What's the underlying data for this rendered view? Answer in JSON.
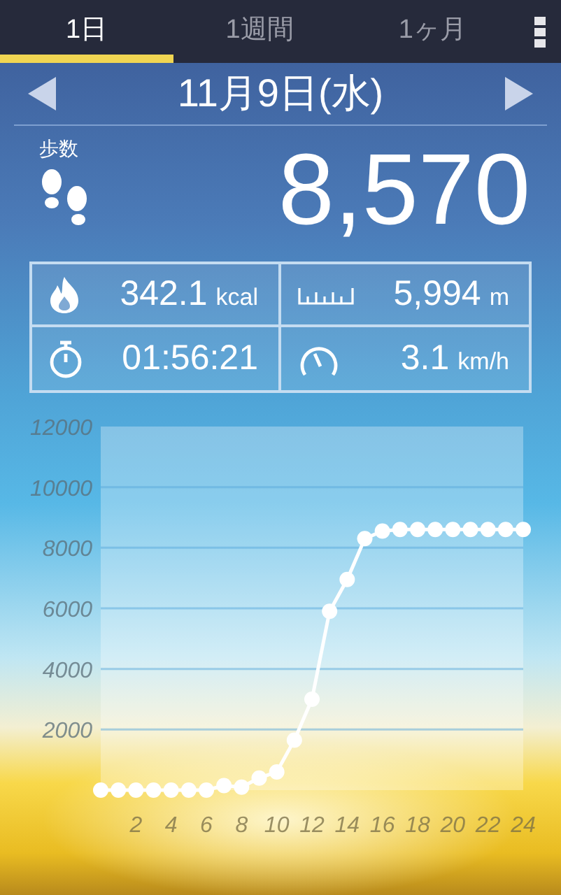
{
  "tabs": [
    {
      "label": "1日",
      "selected": true
    },
    {
      "label": "1週間",
      "selected": false
    },
    {
      "label": "1ヶ月",
      "selected": false
    }
  ],
  "date": "11月9日(水)",
  "steps": {
    "label": "歩数",
    "value": "8,570"
  },
  "stats": [
    {
      "kind": "calories",
      "value": "342.1",
      "unit": "kcal"
    },
    {
      "kind": "distance",
      "value": "5,994",
      "unit": "m"
    },
    {
      "kind": "time",
      "value": "01:56:21"
    },
    {
      "kind": "speed",
      "value": "3.1",
      "unit": "km/h"
    }
  ],
  "chart_data": {
    "type": "line",
    "x": [
      0,
      1,
      2,
      3,
      4,
      5,
      6,
      7,
      8,
      9,
      10,
      11,
      12,
      13,
      14,
      15,
      16,
      17,
      18,
      19,
      20,
      21,
      22,
      23,
      24
    ],
    "xlim": [
      0,
      24
    ],
    "ylim": [
      0,
      12000
    ],
    "xticks": [
      2,
      4,
      6,
      8,
      10,
      12,
      14,
      16,
      18,
      20,
      22,
      24
    ],
    "yticks": [
      2000,
      4000,
      6000,
      8000,
      10000,
      12000
    ],
    "grid": true,
    "series": [
      {
        "color": "#ffffff",
        "marker": true,
        "values": [
          0,
          0,
          0,
          0,
          0,
          0,
          0,
          150,
          100,
          400,
          600,
          1650,
          3000,
          5900,
          6950,
          8300,
          8550,
          8600,
          8600,
          8600,
          8600,
          8600,
          8600,
          8600,
          8600
        ]
      }
    ]
  }
}
